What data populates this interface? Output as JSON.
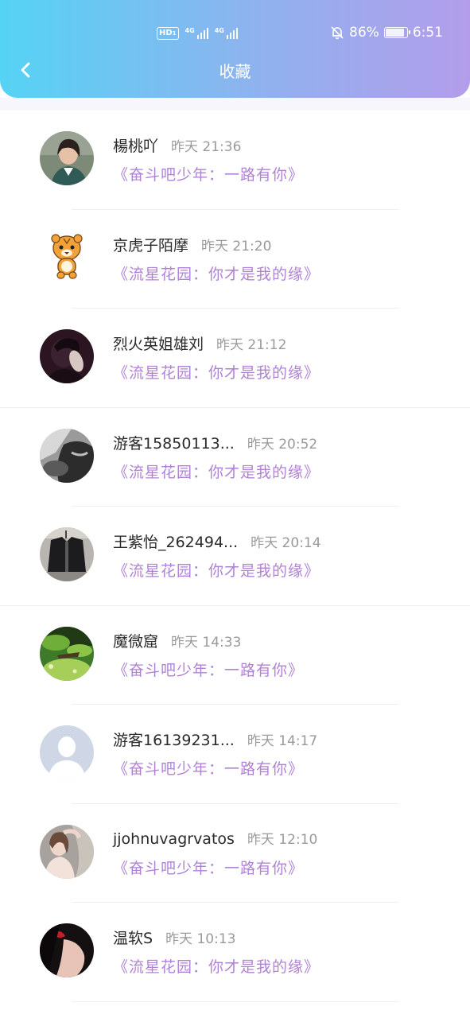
{
  "status": {
    "hd": "HD",
    "hd_sub": "1",
    "net1": "4G",
    "net2": "4G",
    "battery": "86%",
    "time": "6:51"
  },
  "header": {
    "title": "收藏"
  },
  "items": [
    {
      "name": "楊桃吖",
      "time": "昨天 21:36",
      "work": "《奋斗吧少年：一路有你》",
      "avatar": "photo-girl-icon"
    },
    {
      "name": "京虎子陌摩",
      "time": "昨天 21:20",
      "work": "《流星花园：你才是我的缘》",
      "avatar": "tiger-icon"
    },
    {
      "name": "烈火英姐雄刘",
      "time": "昨天 21:12",
      "work": "《流星花园：你才是我的缘》",
      "avatar": "photo-dark-icon"
    },
    {
      "name": "游客15850113...",
      "time": "昨天 20:52",
      "work": "《流星花园：你才是我的缘》",
      "avatar": "photo-gray-icon"
    },
    {
      "name": "王紫怡_262494...",
      "time": "昨天 20:14",
      "work": "《流星花园：你才是我的缘》",
      "avatar": "photo-jacket-icon"
    },
    {
      "name": "魔微窟",
      "time": "昨天 14:33",
      "work": "《奋斗吧少年：一路有你》",
      "avatar": "photo-aquarium-icon"
    },
    {
      "name": "游客16139231...",
      "time": "昨天 14:17",
      "work": "《奋斗吧少年：一路有你》",
      "avatar": "default-user-icon"
    },
    {
      "name": "jjohnuvagrvatos",
      "time": "昨天 12:10",
      "work": "《奋斗吧少年：一路有你》",
      "avatar": "photo-woman-icon"
    },
    {
      "name": "温软S",
      "time": "昨天 10:13",
      "work": "《流星花园：你才是我的缘》",
      "avatar": "photo-lips-icon"
    }
  ],
  "colors": {
    "header_gradient_start": "#55d3f5",
    "header_gradient_end": "#b39deb",
    "work_title": "#b082d6",
    "timestamp": "#9a9a9a"
  }
}
